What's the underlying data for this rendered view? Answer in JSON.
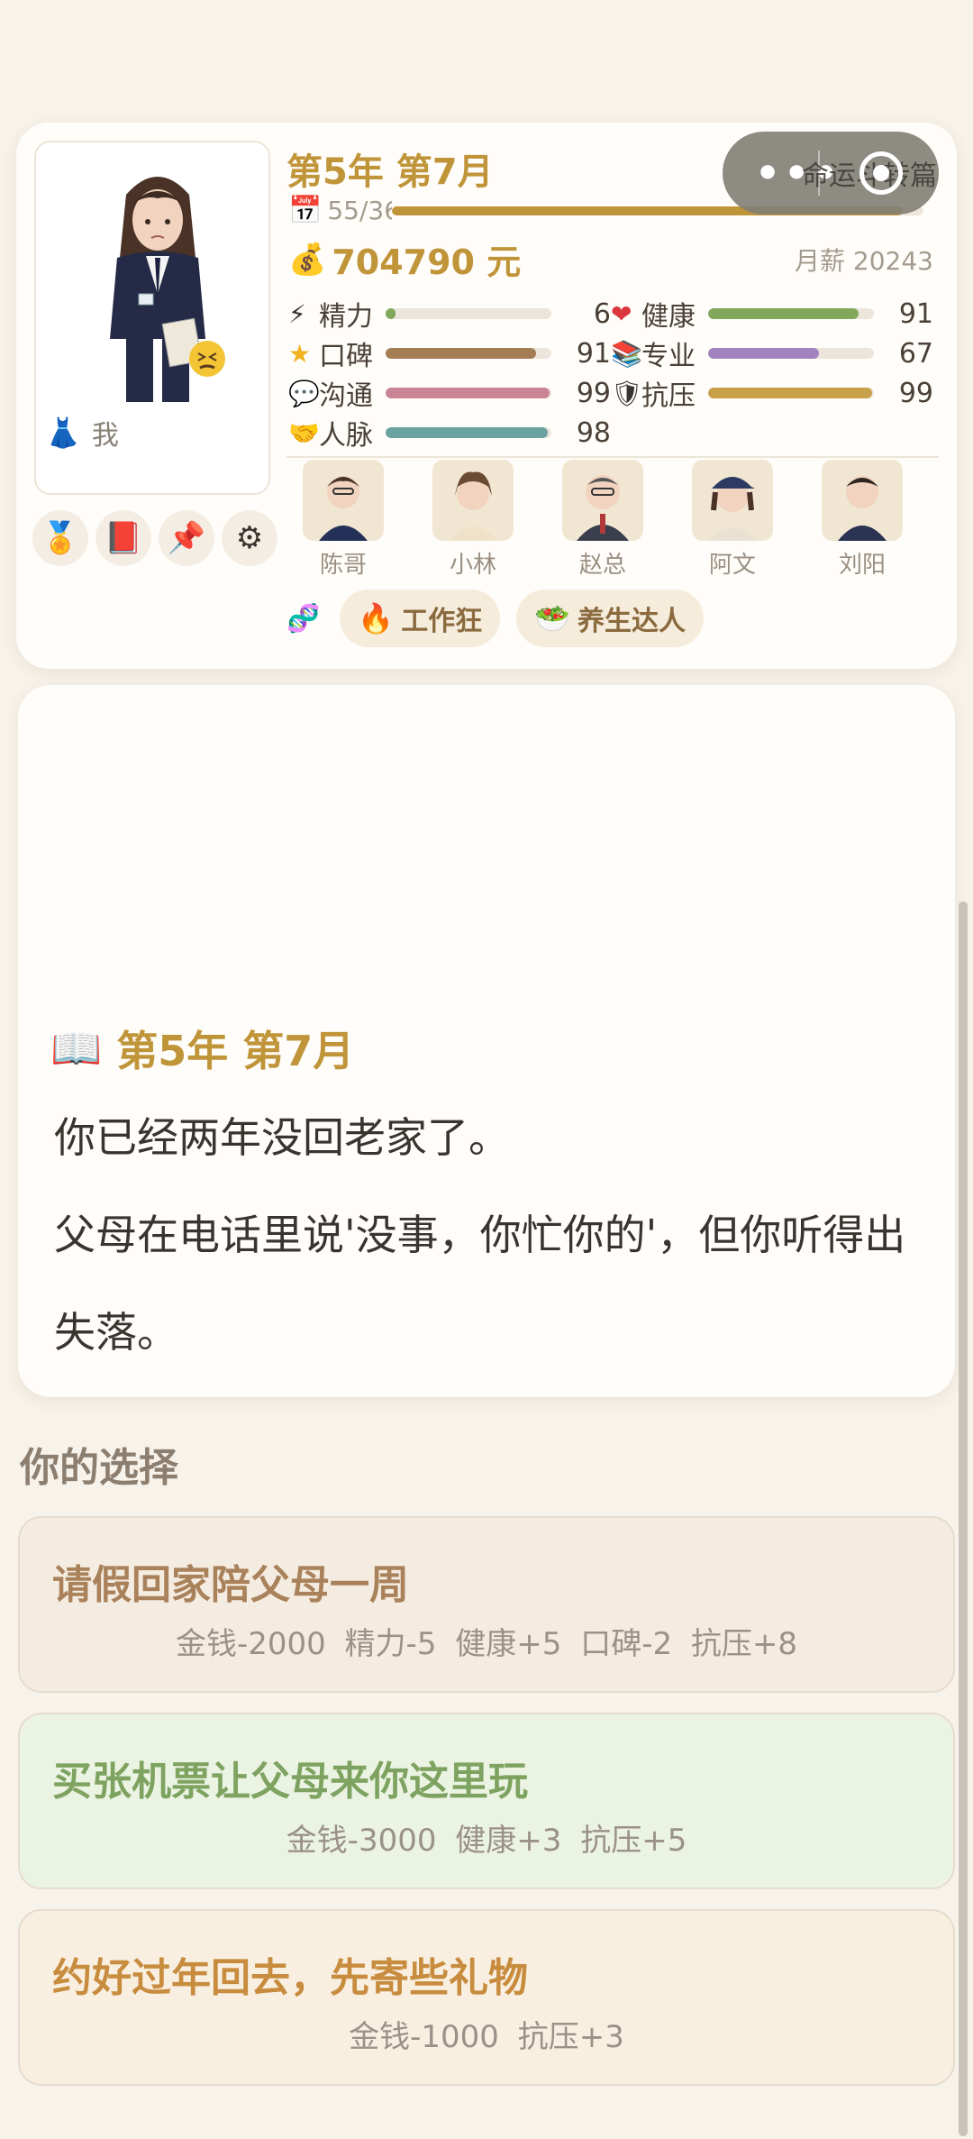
{
  "header": {
    "title": "第5年 第7月",
    "month_progress": {
      "text": "55/36",
      "fraction": 0.96
    },
    "money": "704790 元",
    "salary": "月薪 20243",
    "player_label": "我"
  },
  "capsule": {
    "dots": "•••",
    "text": "命运斗转篇"
  },
  "stats": [
    {
      "label": "精力",
      "value": "6",
      "level": 0.06,
      "color": "#7fa85a",
      "icon": "lightning-icon"
    },
    {
      "label": "健康",
      "value": "91",
      "level": 0.91,
      "color": "#7fa85a",
      "icon": "heart-icon"
    },
    {
      "label": "口碑",
      "value": "91",
      "level": 0.91,
      "color": "#a57d55",
      "icon": "star-icon"
    },
    {
      "label": "专业",
      "value": "67",
      "level": 0.67,
      "color": "#a184bd",
      "icon": "books-icon"
    },
    {
      "label": "沟通",
      "value": "99",
      "level": 0.99,
      "color": "#cb8396",
      "icon": "speech-bubble-icon"
    },
    {
      "label": "抗压",
      "value": "99",
      "level": 0.99,
      "color": "#c9a04a",
      "icon": "shield-icon"
    },
    {
      "label": "人脉",
      "value": "98",
      "level": 0.98,
      "color": "#6aa2a0",
      "icon": "handshake-icon"
    }
  ],
  "npcs": [
    "陈哥",
    "小林",
    "赵总",
    "阿文",
    "刘阳"
  ],
  "tags": [
    {
      "icon": "fire-icon",
      "label": "工作狂"
    },
    {
      "icon": "salad-icon",
      "label": "养生达人"
    }
  ],
  "story": {
    "title": "第5年 第7月",
    "paragraphs": [
      "你已经两年没回老家了。",
      "父母在电话里说'没事，你忙你的'，但你听得出失落。"
    ]
  },
  "choices_title": "你的选择",
  "choices": [
    {
      "title": "请假回家陪父母一周",
      "effects": "金钱-2000 精力-5 健康+5 口碑-2 抗压+8",
      "color": "#a9825b",
      "bg": "#f5ece1"
    },
    {
      "title": "买张机票让父母来你这里玩",
      "effects": "金钱-3000 健康+3 抗压+5",
      "color": "#7ea360",
      "bg": "#ebf3e3"
    },
    {
      "title": "约好过年回去，先寄些礼物",
      "effects": "金钱-1000 抗压+3",
      "color": "#c88c3e",
      "bg": "#f9efe1"
    }
  ]
}
